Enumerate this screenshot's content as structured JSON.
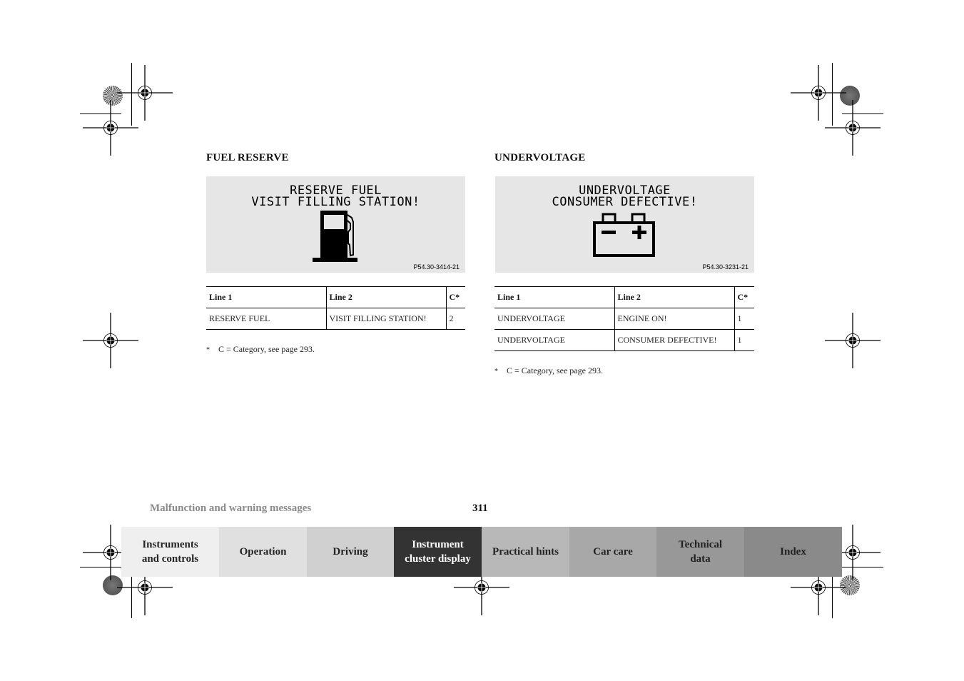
{
  "left_section": {
    "heading": "FUEL RESERVE",
    "display": {
      "line1": "RESERVE FUEL",
      "line2": "VISIT FILLING STATION!",
      "icon": "fuel-pump-icon",
      "figure_code": "P54.30-3414-21"
    },
    "table": {
      "headers": [
        "Line 1",
        "Line 2",
        "C*"
      ],
      "rows": [
        [
          "RESERVE FUEL",
          "VISIT FILLING STATION!",
          "2"
        ]
      ]
    },
    "footnote_marker": "*",
    "footnote": "C = Category, see page 293."
  },
  "right_section": {
    "heading": "UNDERVOLTAGE",
    "display": {
      "line1": "UNDERVOLTAGE",
      "line2": "CONSUMER DEFECTIVE!",
      "icon": "battery-icon",
      "figure_code": "P54.30-3231-21"
    },
    "table": {
      "headers": [
        "Line 1",
        "Line 2",
        "C*"
      ],
      "rows": [
        [
          "UNDERVOLTAGE",
          "ENGINE ON!",
          "1"
        ],
        [
          "UNDERVOLTAGE",
          "CONSUMER DEFECTIVE!",
          "1"
        ]
      ]
    },
    "footnote_marker": "*",
    "footnote": "C = Category, see page 293."
  },
  "footer": {
    "section_title": "Malfunction and warning messages",
    "page_number": "311",
    "nav_tabs": [
      {
        "label_line1": "Instruments",
        "label_line2": "and controls",
        "bg": "#efefef",
        "active": false
      },
      {
        "label_line1": "Operation",
        "label_line2": "",
        "bg": "#e0e0e0",
        "active": false
      },
      {
        "label_line1": "Driving",
        "label_line2": "",
        "bg": "#d0d0d0",
        "active": false
      },
      {
        "label_line1": "Instrument",
        "label_line2": "cluster display",
        "bg": "#333333",
        "active": true
      },
      {
        "label_line1": "Practical hints",
        "label_line2": "",
        "bg": "#b8b8b8",
        "active": false
      },
      {
        "label_line1": "Car care",
        "label_line2": "",
        "bg": "#a8a8a8",
        "active": false
      },
      {
        "label_line1": "Technical",
        "label_line2": "data",
        "bg": "#989898",
        "active": false
      },
      {
        "label_line1": "Index",
        "label_line2": "",
        "bg": "#8a8a8a",
        "active": false
      }
    ]
  }
}
